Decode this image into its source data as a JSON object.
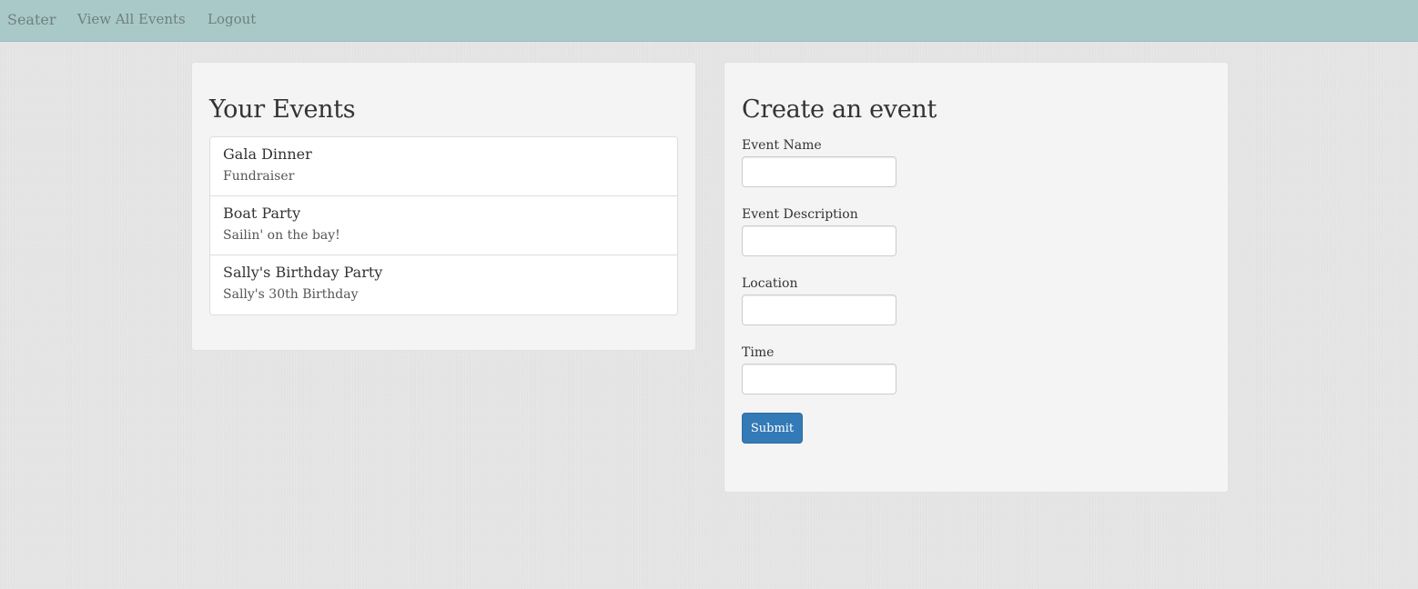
{
  "nav": {
    "brand": "Seater",
    "view_all": "View All Events",
    "logout": "Logout"
  },
  "your_events": {
    "title": "Your Events",
    "items": [
      {
        "name": "Gala Dinner",
        "description": "Fundraiser"
      },
      {
        "name": "Boat Party",
        "description": "Sailin' on the bay!"
      },
      {
        "name": "Sally's Birthday Party",
        "description": "Sally's 30th Birthday"
      }
    ]
  },
  "create_event": {
    "title": "Create an event",
    "fields": {
      "name_label": "Event Name",
      "description_label": "Event Description",
      "location_label": "Location",
      "time_label": "Time"
    },
    "values": {
      "name": "",
      "description": "",
      "location": "",
      "time": ""
    },
    "submit_label": "Submit"
  },
  "colors": {
    "navbar": "#a9c9c8",
    "background": "#e5e5e5",
    "panel": "#f4f4f4",
    "primary_button": "#337ab7"
  }
}
